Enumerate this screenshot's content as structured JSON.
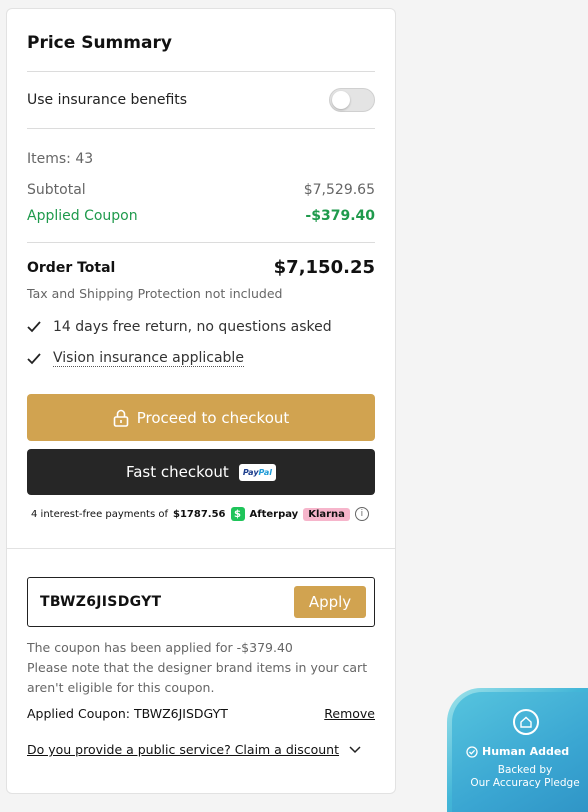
{
  "summary": {
    "title": "Price Summary",
    "insurance_label": "Use insurance benefits",
    "insurance_enabled": false,
    "items_label": "Items: 43",
    "subtotal_label": "Subtotal",
    "subtotal_value": "$7,529.65",
    "coupon_label": "Applied Coupon",
    "coupon_value": "-$379.40",
    "total_label": "Order Total",
    "total_value": "$7,150.25",
    "tax_note": "Tax and Shipping Protection not included",
    "benefits": [
      "14 days free return, no questions asked",
      "Vision insurance applicable"
    ]
  },
  "actions": {
    "checkout_label": "Proceed to checkout",
    "fast_checkout_label": "Fast checkout",
    "paypal_text_a": "Pay",
    "paypal_text_b": "Pal"
  },
  "installments": {
    "text_prefix": "4 interest-free payments of",
    "amount": "$1787.56",
    "cashapp_symbol": "$",
    "afterpay": "Afterpay",
    "klarna": "Klarna",
    "info_symbol": "i"
  },
  "coupon": {
    "code": "TBWZ6JISDGYT",
    "apply_label": "Apply",
    "note_line1": "The coupon has been applied for -$379.40",
    "note_line2": "Please note that the designer brand items in your cart",
    "note_line3": "aren't eligible for this coupon.",
    "applied_text": "Applied Coupon: TBWZ6JISDGYT",
    "remove_label": "Remove",
    "claim_label": "Do you provide a public service? Claim a discount"
  },
  "badge": {
    "title": "Human Added",
    "sub_line1": "Backed by",
    "sub_line2": "Our Accuracy Pledge"
  },
  "colors": {
    "accent_gold": "#d1a350",
    "dark_button": "#262626",
    "green": "#1f9a4c",
    "badge_blue": "#3aa6d2"
  }
}
